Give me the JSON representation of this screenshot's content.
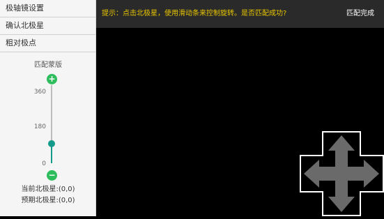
{
  "sidebar": {
    "items": [
      {
        "label": "极轴镜设置"
      },
      {
        "label": "确认北极星"
      },
      {
        "label": "粗对极点"
      }
    ],
    "template_label": "匹配蒙版",
    "slider": {
      "plus_symbol": "+",
      "minus_symbol": "−",
      "ticks": [
        "360",
        "180",
        "0"
      ],
      "min": 0,
      "max": 360,
      "value": 90,
      "color": "#139a8a"
    },
    "current_star": "当前北极星:(0,0)",
    "expected_star": "预期北极星:(0,0)"
  },
  "topbar": {
    "hint": "提示：点击北极星，使用滑动条来控制旋转。是否匹配成功?",
    "done_label": "匹配完成"
  },
  "icons": [
    "plus-icon",
    "minus-icon",
    "move-arrows-icon"
  ]
}
